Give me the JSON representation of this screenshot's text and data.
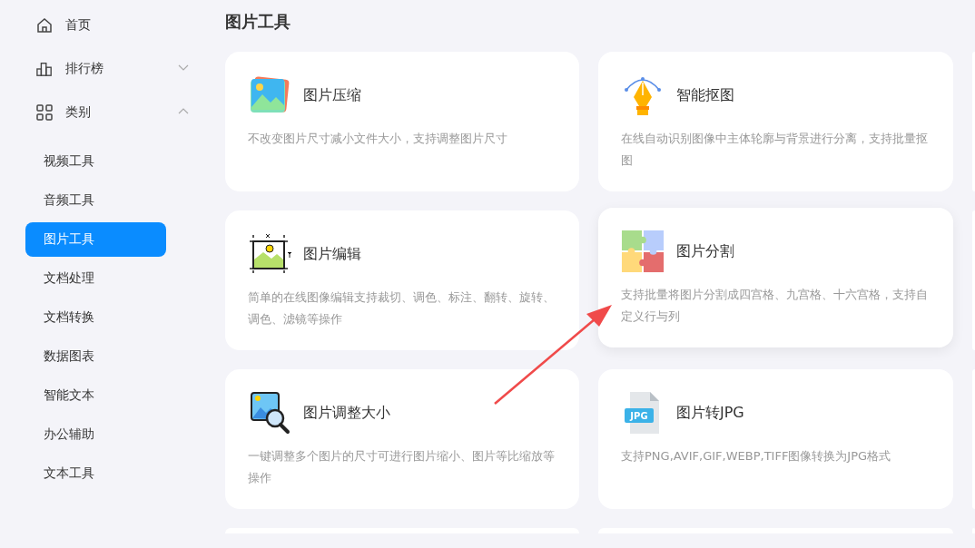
{
  "sidebar": {
    "items": [
      {
        "label": "首页",
        "kind": "home"
      },
      {
        "label": "排行榜",
        "kind": "chart",
        "expanded": false
      },
      {
        "label": "类别",
        "kind": "grid",
        "expanded": true,
        "children": [
          {
            "label": "视频工具",
            "selected": false
          },
          {
            "label": "音频工具",
            "selected": false
          },
          {
            "label": "图片工具",
            "selected": true
          },
          {
            "label": "文档处理",
            "selected": false
          },
          {
            "label": "文档转换",
            "selected": false
          },
          {
            "label": "数据图表",
            "selected": false
          },
          {
            "label": "智能文本",
            "selected": false
          },
          {
            "label": "办公辅助",
            "selected": false
          },
          {
            "label": "文本工具",
            "selected": false
          }
        ]
      }
    ]
  },
  "page_title": "图片工具",
  "cards": [
    {
      "kind": "image",
      "title": "图片压缩",
      "description": "不改变图片尺寸减小文件大小，支持调整图片尺寸",
      "hovered": false
    },
    {
      "kind": "pen",
      "title": "智能抠图",
      "description": "在线自动识别图像中主体轮廓与背景进行分离，支持批量抠图",
      "hovered": false
    },
    {
      "kind": "edit",
      "title": "图片编辑",
      "description": "简单的在线图像编辑支持裁切、调色、标注、翻转、旋转、调色、滤镜等操作",
      "hovered": false
    },
    {
      "kind": "puzzle",
      "title": "图片分割",
      "description": "支持批量将图片分割成四宫格、九宫格、十六宫格，支持自定义行与列",
      "hovered": true
    },
    {
      "kind": "resize",
      "title": "图片调整大小",
      "description": "一键调整多个图片的尺寸可进行图片缩小、图片等比缩放等操作",
      "hovered": false
    },
    {
      "kind": "file",
      "title": "图片转JPG",
      "description": "支持PNG,AVIF,GIF,WEBP,TIFF图像转换为JPG格式",
      "icon_text": "JPG",
      "hovered": false
    }
  ]
}
